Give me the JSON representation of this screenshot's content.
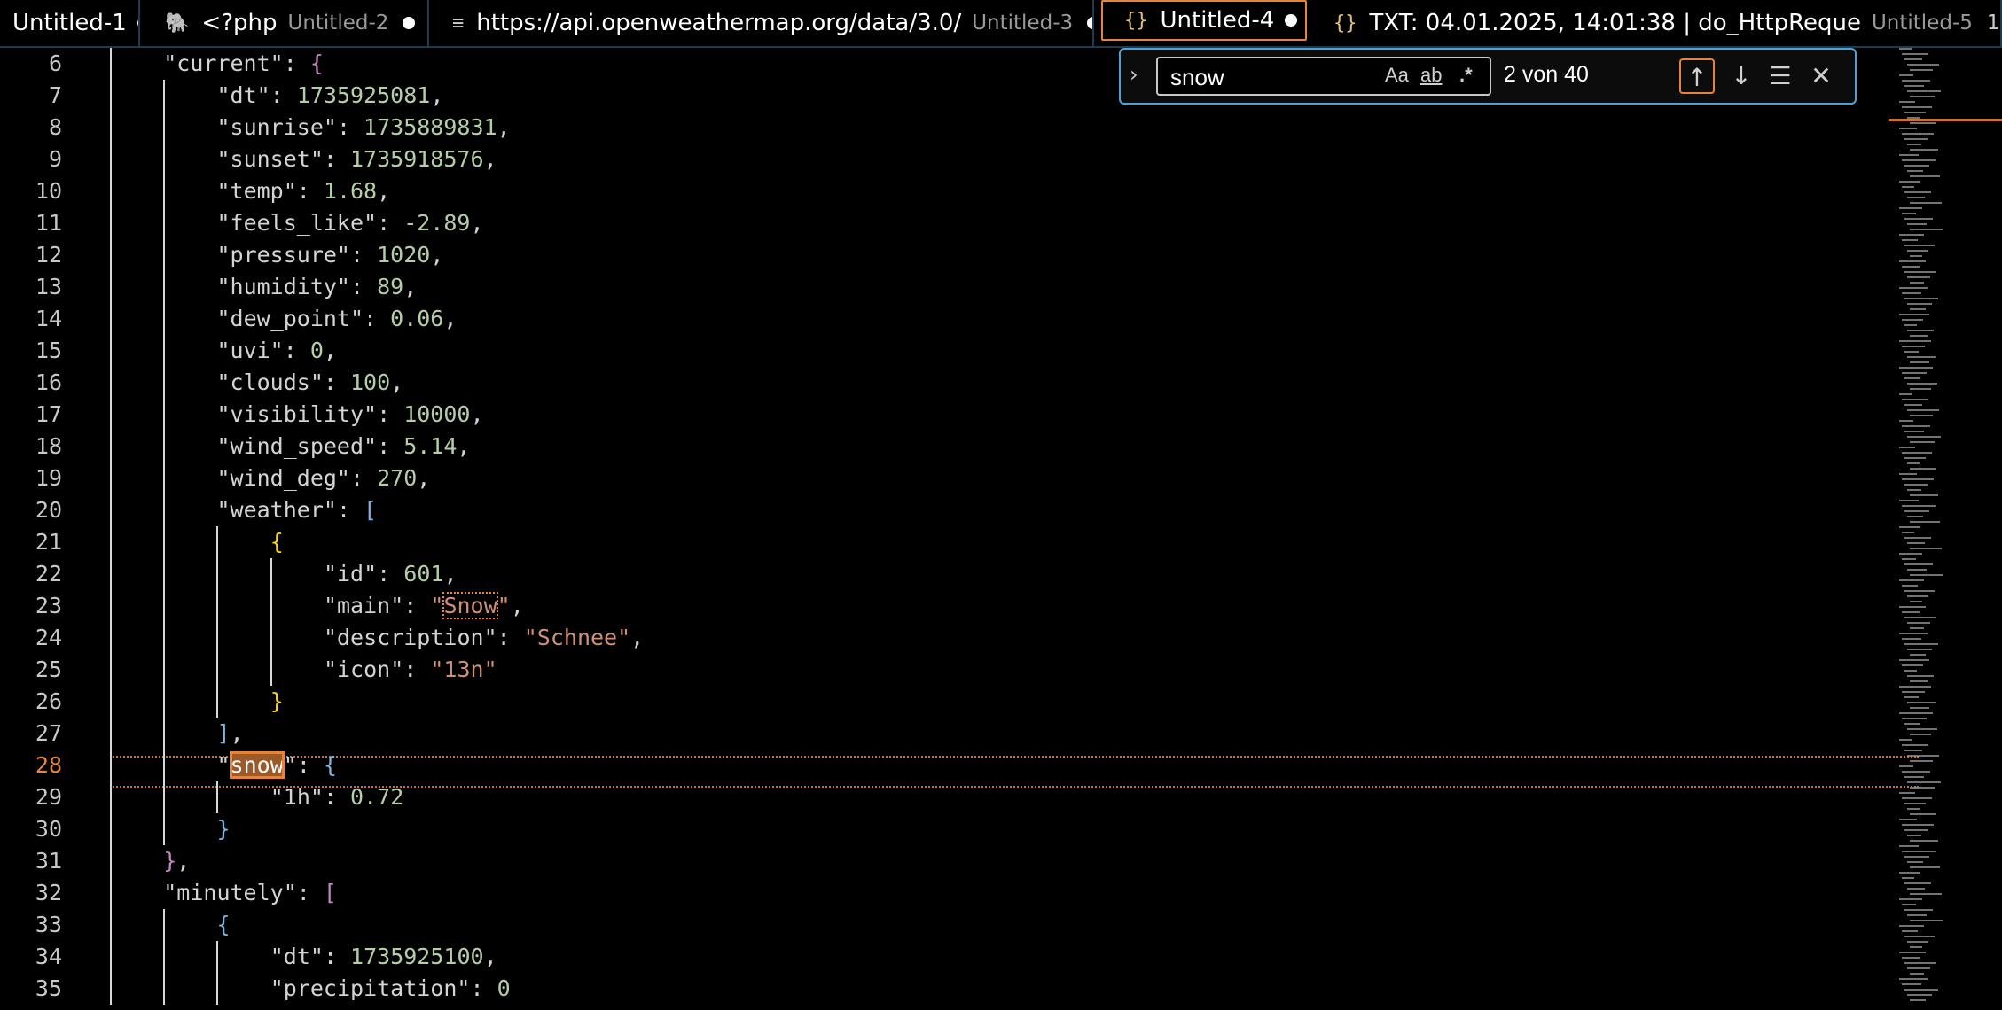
{
  "tabs": [
    {
      "icon": "",
      "icon_name": "",
      "title": "Untitled-1",
      "desc": "",
      "badge": "",
      "dirty": true,
      "active": false
    },
    {
      "icon": "🐘",
      "icon_name": "php-icon",
      "title": "<?php",
      "desc": "Untitled-2",
      "badge": "",
      "dirty": true,
      "active": false
    },
    {
      "icon": "≡",
      "icon_name": "text-file-icon",
      "title": "https://api.openweathermap.org/data/3.0/",
      "desc": "Untitled-3",
      "badge": "",
      "dirty": true,
      "active": false
    },
    {
      "icon": "{}",
      "icon_name": "json-file-icon",
      "title": "Untitled-4",
      "desc": "",
      "badge": "",
      "dirty": true,
      "active": true
    },
    {
      "icon": "{}",
      "icon_name": "json-file-icon",
      "title": "TXT: 04.01.2025, 14:01:38 | do_HttpReque",
      "desc": "Untitled-5",
      "badge": "1",
      "dirty": true,
      "active": false
    }
  ],
  "find": {
    "query": "snow",
    "match_case_label": "Aa",
    "whole_word_label": "ab",
    "regex_label": ".*",
    "count": "2 von 40"
  },
  "editor": {
    "current_line": 28,
    "lines": [
      {
        "n": 6,
        "indent": 1,
        "tokens": [
          [
            "k",
            "\"current\""
          ],
          [
            "p",
            ": "
          ],
          [
            "b1",
            "{"
          ]
        ]
      },
      {
        "n": 7,
        "indent": 2,
        "tokens": [
          [
            "k",
            "\"dt\""
          ],
          [
            "p",
            ": "
          ],
          [
            "n",
            "1735925081"
          ],
          [
            "p",
            ","
          ]
        ]
      },
      {
        "n": 8,
        "indent": 2,
        "tokens": [
          [
            "k",
            "\"sunrise\""
          ],
          [
            "p",
            ": "
          ],
          [
            "n",
            "1735889831"
          ],
          [
            "p",
            ","
          ]
        ]
      },
      {
        "n": 9,
        "indent": 2,
        "tokens": [
          [
            "k",
            "\"sunset\""
          ],
          [
            "p",
            ": "
          ],
          [
            "n",
            "1735918576"
          ],
          [
            "p",
            ","
          ]
        ]
      },
      {
        "n": 10,
        "indent": 2,
        "tokens": [
          [
            "k",
            "\"temp\""
          ],
          [
            "p",
            ": "
          ],
          [
            "n",
            "1.68"
          ],
          [
            "p",
            ","
          ]
        ]
      },
      {
        "n": 11,
        "indent": 2,
        "tokens": [
          [
            "k",
            "\"feels_like\""
          ],
          [
            "p",
            ": "
          ],
          [
            "n",
            "-2.89"
          ],
          [
            "p",
            ","
          ]
        ]
      },
      {
        "n": 12,
        "indent": 2,
        "tokens": [
          [
            "k",
            "\"pressure\""
          ],
          [
            "p",
            ": "
          ],
          [
            "n",
            "1020"
          ],
          [
            "p",
            ","
          ]
        ]
      },
      {
        "n": 13,
        "indent": 2,
        "tokens": [
          [
            "k",
            "\"humidity\""
          ],
          [
            "p",
            ": "
          ],
          [
            "n",
            "89"
          ],
          [
            "p",
            ","
          ]
        ]
      },
      {
        "n": 14,
        "indent": 2,
        "tokens": [
          [
            "k",
            "\"dew_point\""
          ],
          [
            "p",
            ": "
          ],
          [
            "n",
            "0.06"
          ],
          [
            "p",
            ","
          ]
        ]
      },
      {
        "n": 15,
        "indent": 2,
        "tokens": [
          [
            "k",
            "\"uvi\""
          ],
          [
            "p",
            ": "
          ],
          [
            "n",
            "0"
          ],
          [
            "p",
            ","
          ]
        ]
      },
      {
        "n": 16,
        "indent": 2,
        "tokens": [
          [
            "k",
            "\"clouds\""
          ],
          [
            "p",
            ": "
          ],
          [
            "n",
            "100"
          ],
          [
            "p",
            ","
          ]
        ]
      },
      {
        "n": 17,
        "indent": 2,
        "tokens": [
          [
            "k",
            "\"visibility\""
          ],
          [
            "p",
            ": "
          ],
          [
            "n",
            "10000"
          ],
          [
            "p",
            ","
          ]
        ]
      },
      {
        "n": 18,
        "indent": 2,
        "tokens": [
          [
            "k",
            "\"wind_speed\""
          ],
          [
            "p",
            ": "
          ],
          [
            "n",
            "5.14"
          ],
          [
            "p",
            ","
          ]
        ]
      },
      {
        "n": 19,
        "indent": 2,
        "tokens": [
          [
            "k",
            "\"wind_deg\""
          ],
          [
            "p",
            ": "
          ],
          [
            "n",
            "270"
          ],
          [
            "p",
            ","
          ]
        ]
      },
      {
        "n": 20,
        "indent": 2,
        "tokens": [
          [
            "k",
            "\"weather\""
          ],
          [
            "p",
            ": "
          ],
          [
            "b3",
            "["
          ]
        ]
      },
      {
        "n": 21,
        "indent": 3,
        "tokens": [
          [
            "b2",
            "{"
          ]
        ]
      },
      {
        "n": 22,
        "indent": 4,
        "tokens": [
          [
            "k",
            "\"id\""
          ],
          [
            "p",
            ": "
          ],
          [
            "n",
            "601"
          ],
          [
            "p",
            ","
          ]
        ]
      },
      {
        "n": 23,
        "indent": 4,
        "tokens": [
          [
            "k",
            "\"main\""
          ],
          [
            "p",
            ": "
          ],
          [
            "s",
            "\""
          ],
          [
            "sm",
            "Snow"
          ],
          [
            "s",
            "\""
          ],
          [
            "p",
            ","
          ]
        ]
      },
      {
        "n": 24,
        "indent": 4,
        "tokens": [
          [
            "k",
            "\"description\""
          ],
          [
            "p",
            ": "
          ],
          [
            "s",
            "\"Schnee\""
          ],
          [
            "p",
            ","
          ]
        ]
      },
      {
        "n": 25,
        "indent": 4,
        "tokens": [
          [
            "k",
            "\"icon\""
          ],
          [
            "p",
            ": "
          ],
          [
            "s",
            "\"13n\""
          ]
        ]
      },
      {
        "n": 26,
        "indent": 3,
        "tokens": [
          [
            "b2",
            "}"
          ]
        ]
      },
      {
        "n": 27,
        "indent": 2,
        "tokens": [
          [
            "b3",
            "]"
          ],
          [
            "p",
            ","
          ]
        ]
      },
      {
        "n": 28,
        "indent": 2,
        "tokens": [
          [
            "k",
            "\""
          ],
          [
            "mc",
            "snow"
          ],
          [
            "k",
            "\""
          ],
          [
            "p",
            ": "
          ],
          [
            "b3",
            "{"
          ]
        ]
      },
      {
        "n": 29,
        "indent": 3,
        "tokens": [
          [
            "k",
            "\"1h\""
          ],
          [
            "p",
            ": "
          ],
          [
            "n",
            "0.72"
          ]
        ]
      },
      {
        "n": 30,
        "indent": 2,
        "tokens": [
          [
            "b3",
            "}"
          ]
        ]
      },
      {
        "n": 31,
        "indent": 1,
        "tokens": [
          [
            "b1",
            "}"
          ],
          [
            "p",
            ","
          ]
        ]
      },
      {
        "n": 32,
        "indent": 1,
        "tokens": [
          [
            "k",
            "\"minutely\""
          ],
          [
            "p",
            ": "
          ],
          [
            "b1",
            "["
          ]
        ]
      },
      {
        "n": 33,
        "indent": 2,
        "tokens": [
          [
            "b3",
            "{"
          ]
        ]
      },
      {
        "n": 34,
        "indent": 3,
        "tokens": [
          [
            "k",
            "\"dt\""
          ],
          [
            "p",
            ": "
          ],
          [
            "n",
            "1735925100"
          ],
          [
            "p",
            ","
          ]
        ]
      },
      {
        "n": 35,
        "indent": 3,
        "tokens": [
          [
            "k",
            "\"precipitation\""
          ],
          [
            "p",
            ": "
          ],
          [
            "n",
            "0"
          ]
        ]
      }
    ]
  }
}
